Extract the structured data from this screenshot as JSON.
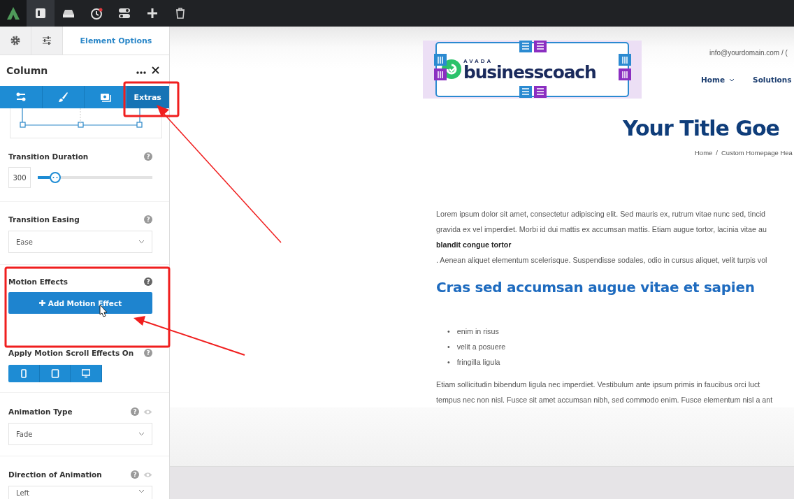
{
  "toolbar": {
    "buttons": [
      {
        "kind": "panel",
        "selected": true
      },
      {
        "kind": "drive",
        "selected": false
      },
      {
        "kind": "history",
        "selected": false
      },
      {
        "kind": "toggles",
        "selected": false
      },
      {
        "kind": "add",
        "selected": false
      },
      {
        "kind": "trash",
        "selected": false
      }
    ]
  },
  "sidebar": {
    "top_tabs": [
      {
        "kind": "settings",
        "selected": false
      },
      {
        "kind": "sliders",
        "selected": false
      },
      {
        "kind": "text",
        "label": "Element Options",
        "selected": true
      }
    ],
    "title": "Column",
    "sub_tabs": [
      {
        "kind": "general",
        "selected": false
      },
      {
        "kind": "design",
        "selected": false
      },
      {
        "kind": "background",
        "selected": false
      },
      {
        "kind": "text",
        "label": "Extras",
        "selected": true
      }
    ],
    "help_glyph": "?",
    "fields": [
      {
        "kind": "slider",
        "label": "Transition Duration",
        "value": "300",
        "level": 0.15
      },
      {
        "kind": "select",
        "label": "Transition Easing",
        "value": "Ease"
      },
      {
        "kind": "button",
        "label": "Motion Effects",
        "button": "Add Motion Effect"
      },
      {
        "kind": "devices",
        "label": "Apply Motion Scroll Effects On",
        "devices": [
          {
            "kind": "mobile"
          },
          {
            "kind": "tablet"
          },
          {
            "kind": "desktop"
          }
        ]
      },
      {
        "kind": "select",
        "label": "Animation Type",
        "value": "Fade",
        "preview": true
      },
      {
        "kind": "select",
        "label": "Direction of Animation",
        "value": "Left",
        "preview": true
      }
    ]
  },
  "preview": {
    "email": "info@yourdomain.com / (",
    "logo": {
      "brand": "AVADA",
      "name": "businesscoach"
    },
    "nav": [
      {
        "label": "Home",
        "dropdown": true
      },
      {
        "label": "Solutions",
        "dropdown": false
      }
    ],
    "title": "Your Title Goe",
    "breadcrumb": [
      "Home",
      "Custom Homepage Hea"
    ],
    "breadcrumb_separator": "/",
    "bullet": "•",
    "paragraph": [
      "Lorem ipsum dolor sit amet, consectetur adipiscing elit. Sed mauris ex, rutrum vitae nunc sed, tincid",
      "gravida ex vel imperdiet. Morbi id dui mattis ex accumsan mattis. Etiam augue tortor, lacinia vitae au"
    ],
    "bold_line": "blandit congue tortor",
    "paragraph_end": ". Aenean aliquet elementum scelerisque. Suspendisse sodales, odio in cursus aliquet, velit turpis vol",
    "heading": "Cras sed accumsan augue vitae et sapien",
    "list": [
      "enim in risus",
      "velit a posuere",
      "fringilla ligula"
    ],
    "paragraph2": [
      "Etiam sollicitudin bibendum ligula nec imperdiet. Vestibulum ante ipsum primis in faucibus orci luct",
      "tempus nec non nisl. Fusce sit amet accumsan nibh, sed commodo enim. Fusce elementum nisl a ant"
    ]
  }
}
